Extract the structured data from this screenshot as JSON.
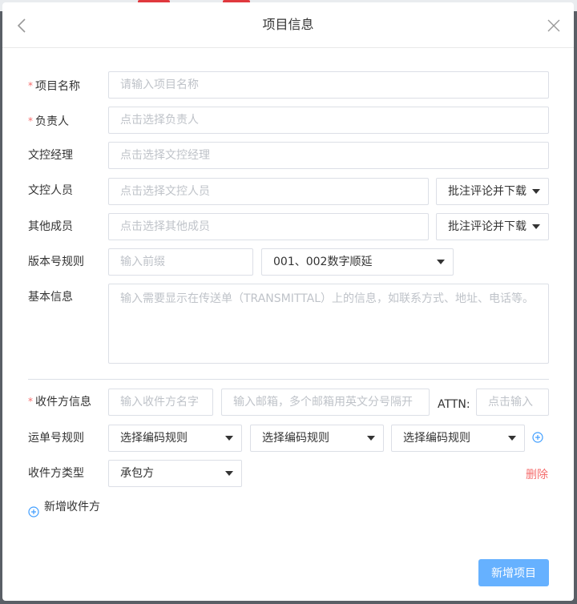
{
  "dialog": {
    "title": "项目信息",
    "back_icon": "chevron-left-icon",
    "close_icon": "close-icon"
  },
  "form": {
    "project_name": {
      "label": "项目名称",
      "required": true,
      "placeholder": "请输入项目名称",
      "value": ""
    },
    "owner": {
      "label": "负责人",
      "required": true,
      "placeholder": "点击选择负责人",
      "value": ""
    },
    "doc_manager": {
      "label": "文控经理",
      "placeholder": "点击选择文控经理",
      "value": ""
    },
    "doc_staff": {
      "label": "文控人员",
      "placeholder": "点击选择文控人员",
      "value": "",
      "permission": "批注评论并下载"
    },
    "other_members": {
      "label": "其他成员",
      "placeholder": "点击选择其他成员",
      "value": "",
      "permission": "批注评论并下载"
    },
    "version_rule": {
      "label": "版本号规则",
      "prefix_placeholder": "输入前缀",
      "rule": "001、002数字顺延"
    },
    "basic_info": {
      "label": "基本信息",
      "placeholder": "输入需要显示在传送单（TRANSMITTAL）上的信息，如联系方式、地址、电话等。",
      "value": ""
    }
  },
  "recipient": {
    "info_label": "收件方信息",
    "required_marker": "*",
    "name_placeholder": "输入收件方名字",
    "email_placeholder": "输入邮箱，多个邮箱用英文分号隔开",
    "attn_label": "ATTN:",
    "attn_placeholder": "点击输入",
    "waybill_label": "运单号规则",
    "waybill_rules": [
      "选择编码规则",
      "选择编码规则",
      "选择编码规则"
    ],
    "type_label": "收件方类型",
    "type_value": "承包方",
    "delete_label": "删除"
  },
  "add_recipient_label": "新增收件方",
  "submit_label": "新增项目",
  "colors": {
    "primary": "#66b1ff",
    "danger": "#f56c6c",
    "required": "#f56c6c"
  }
}
